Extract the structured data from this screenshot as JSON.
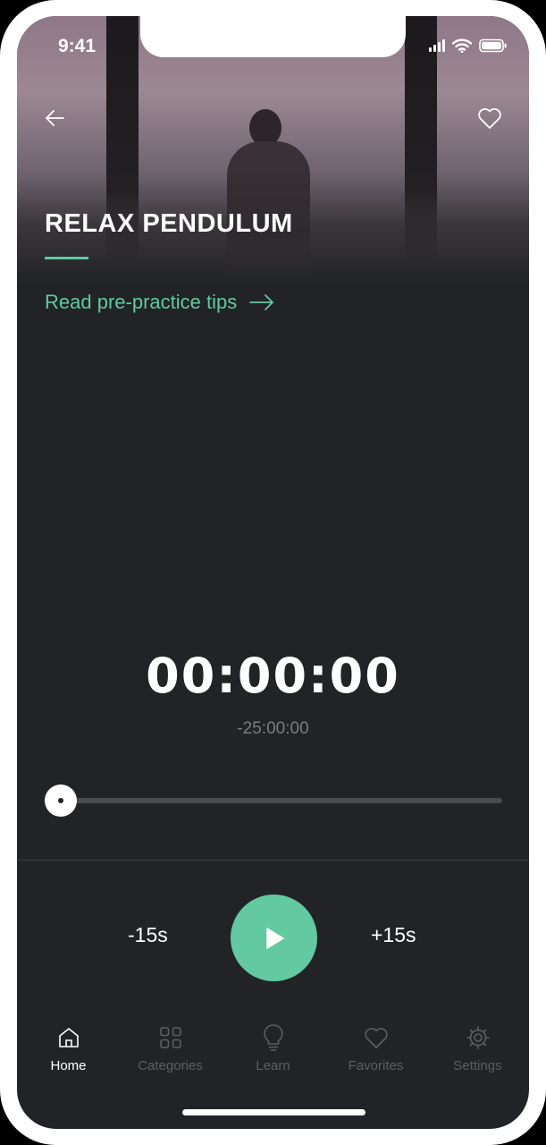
{
  "status_bar": {
    "time": "9:41"
  },
  "header": {
    "back_icon": "arrow-left-icon",
    "favorite_icon": "heart-outline-icon",
    "title": "RELAX PENDULUM",
    "tips_link": "Read pre-practice tips",
    "tips_icon": "arrow-right-icon"
  },
  "player": {
    "elapsed": "00:00:00",
    "remaining": "-25:00:00",
    "progress": 0,
    "rewind_label": "-15s",
    "forward_label": "+15s",
    "play_icon": "play-icon"
  },
  "tabs": [
    {
      "label": "Home",
      "icon": "home-icon",
      "active": true
    },
    {
      "label": "Categories",
      "icon": "grid-icon",
      "active": false
    },
    {
      "label": "Learn",
      "icon": "lightbulb-icon",
      "active": false
    },
    {
      "label": "Favorites",
      "icon": "heart-icon",
      "active": false
    },
    {
      "label": "Settings",
      "icon": "gear-icon",
      "active": false
    }
  ],
  "colors": {
    "accent": "#5fc9a0",
    "background": "#222326",
    "inactive_tab": "#5d5e62"
  }
}
